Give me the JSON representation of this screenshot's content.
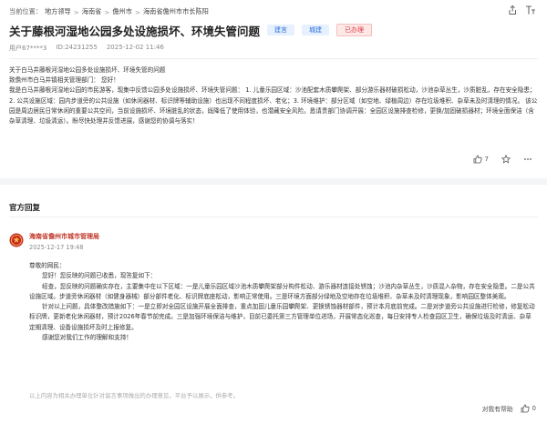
{
  "breadcrumb": {
    "current_label": "当前位置：",
    "items": [
      "地方领导",
      "海南省",
      "儋州市",
      "海南省儋州市市长陈阳"
    ],
    "separator": ">"
  },
  "post": {
    "title": "关于藤根河湿地公园多处设施损坏、环境失管问题",
    "tags": [
      "建言",
      "城建",
      "已办理"
    ],
    "user": "用户67****3",
    "id": "ID:24231255",
    "datetime": "2025-12-02 11:46",
    "paragraphs": [
      "关于白马井藤根河湿地公园多处设施损坏、环境失管的问题",
      "致儋州市白马井镇相关管理部门：  您好！",
      "我是白马井藤根河湿地公园的市民游客，现集中反馈公园多处设施损坏、环境失管问题： 1. 儿童乐园区域：沙池配套木质攀爬架、部分游乐器材破损松动，沙池杂草丛生，沙质脏乱，存在安全隐患；2. 公共设施区域：园内步道旁的公共设施（如休闲器材、标识牌等辅助设施）也出现不同程度损坏、老化；3. 环境维护：部分区域（如空地、绿植周边）存在垃圾堆积、杂草未及时清理的情况。 该公园是周边居民日常休闲的重要公共空间，当前设施损坏、环境脏乱的状态，既降低了使用体验，也潜藏安全风险。恳请贵部门协调开展：全园区设施排查检修，更换/加固破损器材；环境全面保洁（含杂草清理、垃圾清运）。盼尽快处理并反馈进展，感谢您的协调与落实！"
    ],
    "likes": "7"
  },
  "reply": {
    "section_title": "官方回复",
    "org": "海南省儋州市城市管理局",
    "datetime": "2025-12-17 19:48",
    "paragraphs": [
      "尊敬的网民：",
      "您好！您反映的问题已收悉，现答复如下：",
      "经查，您反映的问题确实存在，主要集中在以下区域：一是儿童乐园区域沙池木质攀爬架部分构件松动、游乐器材连接处锈蚀；沙池内杂草丛生，沙质混入杂物，存在安全隐患。二是公共设施区域。步道旁休闲器材（如健身器械）部分部件老化、标识牌底座松动，影响正常使用。三是环境方面部分绿地及空地存在垃圾堆积、杂草未及时清理现象，影响园区整体美观。",
      "针对以上问题，具体整改措施如下：一是立即对全园区设施开展全面排查，重点加固儿童乐园攀爬架、更换锈蚀器材部件，预计本月底前完成。二是对步道旁公共设施进行检修，修复松动标识牌，更新老化休闲器材，预计2026年春节前完成。三是加强环境保洁与维护，目前已委托第三方管理单位进场，开展常态化巡查，每日安排专人检查园区卫生，确保垃圾及时清运、杂草定期清理、设备设施损坏及时上报修复。",
      "感谢您对我们工作的理解和支持！"
    ],
    "disclaimer": "以上内容为相关办理单位针对留言事项做出的办理意见，平台予以展示，供参考。",
    "helpful_label": "对我有帮助",
    "helpful_count": "0"
  },
  "colors": {
    "accent_red": "#e0393e",
    "tag_blue": "#2f6fd6",
    "org_red": "#c0392b"
  },
  "icons": [
    "share-icon",
    "font-size-icon",
    "thumbs-up-icon",
    "star-icon",
    "more-icon",
    "government-emblem-icon"
  ]
}
